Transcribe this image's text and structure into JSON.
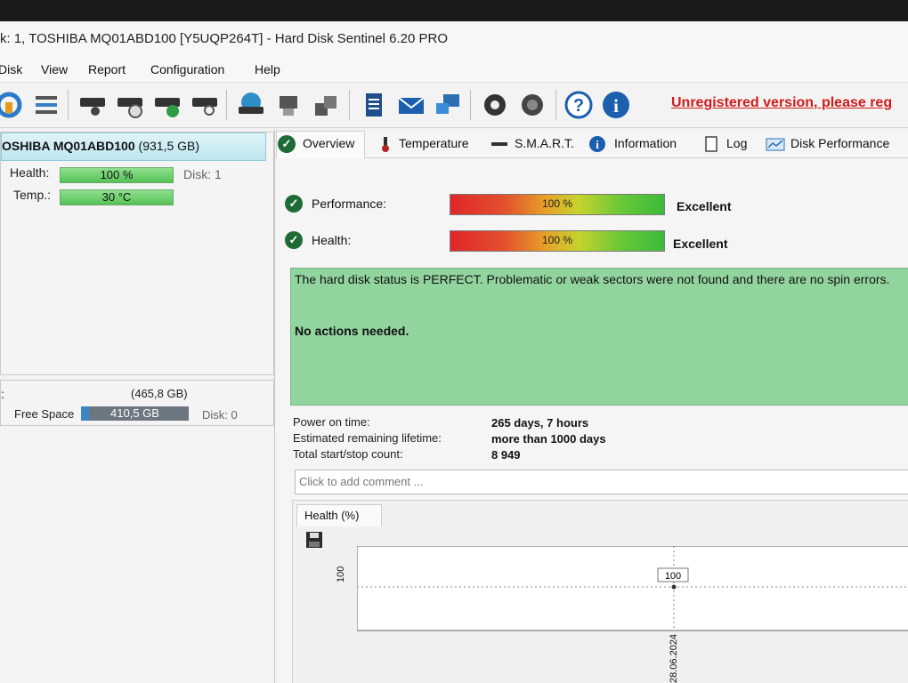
{
  "window": {
    "title": "k: 1, TOSHIBA MQ01ABD100 [Y5UQP264T]  -  Hard Disk Sentinel 6.20 PRO"
  },
  "menu": [
    "Disk",
    "View",
    "Report",
    "Configuration",
    "Help"
  ],
  "toolbar": {
    "icons": [
      "refresh-icon",
      "list-icon",
      "disk-icon",
      "disk-clock-icon",
      "disk-check-icon",
      "disk-search-icon",
      "globe-disk-icon",
      "disk-tools-icon",
      "disk-stack-icon",
      "notepad-icon",
      "email-icon",
      "network-icon",
      "gear-icon",
      "speaker-icon",
      "help-icon",
      "info-icon"
    ],
    "unregistered": "Unregistered version, please reg"
  },
  "left": {
    "disk_name": "OSHIBA MQ01ABD100",
    "disk_size": "(931,5 GB)",
    "health_label": "Health:",
    "health_value": "100 %",
    "disk_label": "Disk: 1",
    "temp_label": "Temp.:",
    "temp_value": "30 °C",
    "partition_colon": ":",
    "partition_size": "(465,8 GB)",
    "free_space_label": "Free Space",
    "free_space_value": "410,5 GB",
    "partition_disk": "Disk: 0"
  },
  "tabs": [
    "Overview",
    "Temperature",
    "S.M.A.R.T.",
    "Information",
    "Log",
    "Disk Performance"
  ],
  "overview": {
    "performance_label": "Performance:",
    "performance_value": "100 %",
    "performance_pct": 100,
    "performance_rating": "Excellent",
    "health_label": "Health:",
    "health_value": "100 %",
    "health_pct": 100,
    "health_rating": "Excellent",
    "status_text": "The hard disk status is PERFECT. Problematic or weak sectors were not found and there are no spin errors.",
    "status_action": "No actions needed.",
    "power_on_label": "Power on time:",
    "power_on_value": "265 days, 7 hours",
    "lifetime_label": "Estimated remaining lifetime:",
    "lifetime_value": "more than 1000 days",
    "startstop_label": "Total start/stop count:",
    "startstop_value": "8 949",
    "comment_placeholder": "Click to add comment ..."
  },
  "chart_tab": "Health (%)",
  "chart_data": {
    "type": "line",
    "title": "Health (%)",
    "x": [
      "28.06.2024"
    ],
    "series": [
      {
        "values": [
          100
        ]
      }
    ],
    "yticks": [
      "100"
    ],
    "data_labels": [
      "100"
    ]
  },
  "colors": {
    "status_green": "#92d49e",
    "unregistered_red": "#d21a1a",
    "accent_blue": "#1c5fae"
  }
}
